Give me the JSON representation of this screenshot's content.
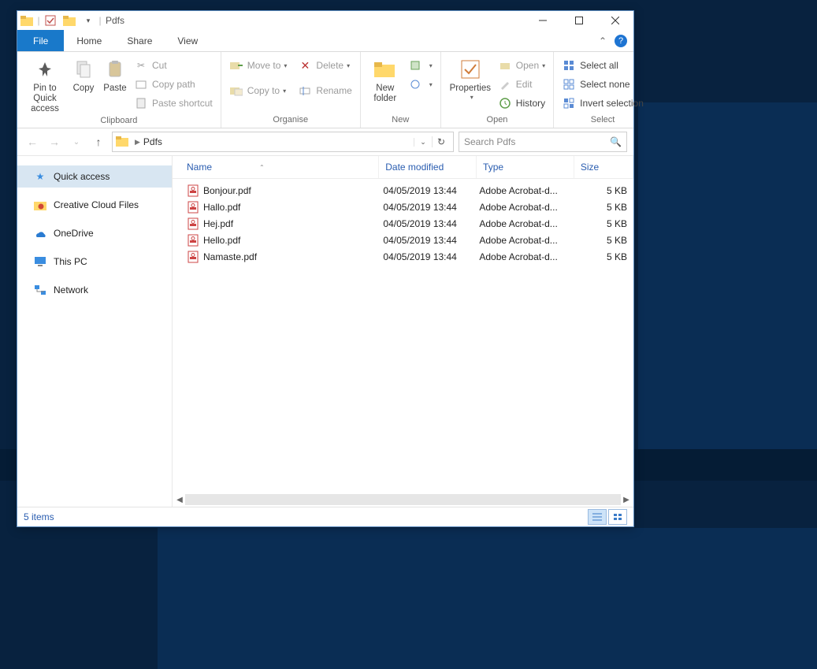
{
  "window_title": "Pdfs",
  "tabs": {
    "file": "File",
    "home": "Home",
    "share": "Share",
    "view": "View"
  },
  "ribbon": {
    "clipboard": {
      "label": "Clipboard",
      "pin": "Pin to Quick\naccess",
      "copy": "Copy",
      "paste": "Paste",
      "cut": "Cut",
      "copy_path": "Copy path",
      "paste_shortcut": "Paste shortcut"
    },
    "organise": {
      "label": "Organise",
      "move_to": "Move to",
      "copy_to": "Copy to",
      "delete": "Delete",
      "rename": "Rename"
    },
    "new_group": {
      "label": "New",
      "new_folder": "New\nfolder"
    },
    "open_group": {
      "label": "Open",
      "properties": "Properties",
      "open": "Open",
      "edit": "Edit",
      "history": "History"
    },
    "select_group": {
      "label": "Select",
      "select_all": "Select all",
      "select_none": "Select none",
      "invert": "Invert selection"
    }
  },
  "address": {
    "folder": "Pdfs"
  },
  "search": {
    "placeholder": "Search Pdfs"
  },
  "navpane": {
    "quick_access": "Quick access",
    "creative_cloud": "Creative Cloud Files",
    "onedrive": "OneDrive",
    "this_pc": "This PC",
    "network": "Network"
  },
  "columns": {
    "name": "Name",
    "date": "Date modified",
    "type": "Type",
    "size": "Size"
  },
  "files": [
    {
      "name": "Bonjour.pdf",
      "date": "04/05/2019 13:44",
      "type": "Adobe Acrobat-d...",
      "size": "5 KB"
    },
    {
      "name": "Hallo.pdf",
      "date": "04/05/2019 13:44",
      "type": "Adobe Acrobat-d...",
      "size": "5 KB"
    },
    {
      "name": "Hej.pdf",
      "date": "04/05/2019 13:44",
      "type": "Adobe Acrobat-d...",
      "size": "5 KB"
    },
    {
      "name": "Hello.pdf",
      "date": "04/05/2019 13:44",
      "type": "Adobe Acrobat-d...",
      "size": "5 KB"
    },
    {
      "name": "Namaste.pdf",
      "date": "04/05/2019 13:44",
      "type": "Adobe Acrobat-d...",
      "size": "5 KB"
    }
  ],
  "status": {
    "items": "5 items"
  }
}
